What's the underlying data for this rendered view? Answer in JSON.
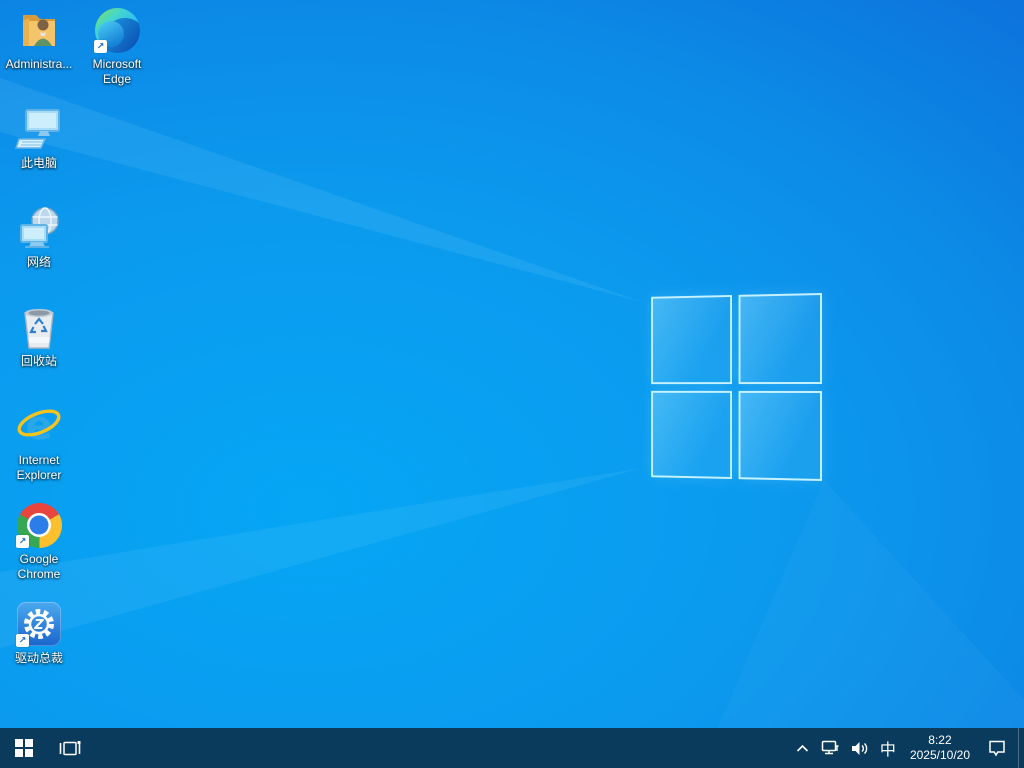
{
  "desktop": {
    "icons": [
      {
        "id": "administrator",
        "label": "Administra..."
      },
      {
        "id": "microsoft-edge",
        "label": "Microsoft Edge"
      },
      {
        "id": "this-pc",
        "label": "此电脑"
      },
      {
        "id": "network",
        "label": "网络"
      },
      {
        "id": "recycle-bin",
        "label": "回收站"
      },
      {
        "id": "internet-explorer",
        "label": "Internet Explorer"
      },
      {
        "id": "google-chrome",
        "label": "Google Chrome"
      },
      {
        "id": "driver-ceo",
        "label": "驱动总裁"
      }
    ],
    "shortcut_arrow": "↗"
  },
  "taskbar": {
    "tray": {
      "ime_indicator": "中",
      "time": "8:22",
      "date": "2025/10/20"
    }
  },
  "colors": {
    "taskbar": "#0a3a5c",
    "wallpaper_bright": "#06a6f5",
    "wallpaper_deep": "#0d4ccd",
    "logo_border": "#cdf6ff"
  }
}
